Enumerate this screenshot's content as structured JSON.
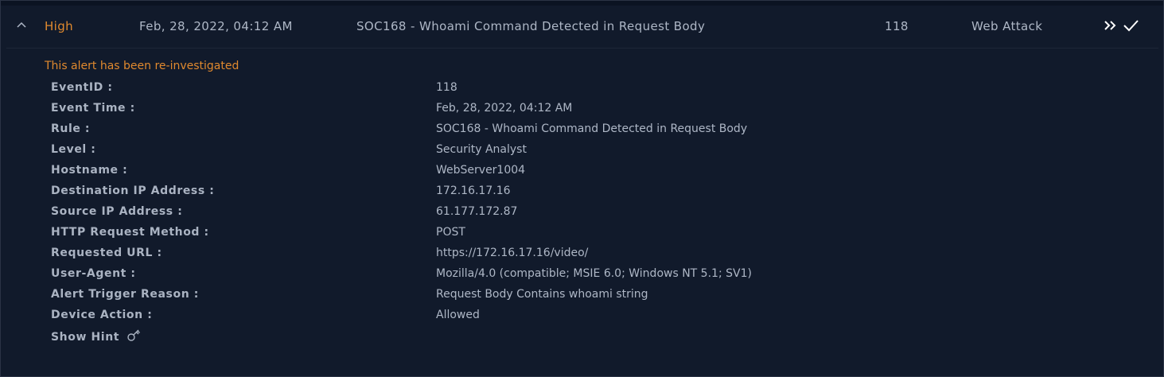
{
  "alert": {
    "severity": "High",
    "datetime": "Feb, 28, 2022, 04:12 AM",
    "rule": "SOC168 - Whoami Command Detected in Request Body",
    "event_id": "118",
    "type": "Web Attack",
    "severity_color": "#e0892e"
  },
  "detail": {
    "notice": "This alert has been re-investigated",
    "fields": [
      {
        "label": "EventID :",
        "value": "118"
      },
      {
        "label": "Event Time :",
        "value": "Feb, 28, 2022, 04:12 AM"
      },
      {
        "label": "Rule :",
        "value": "SOC168 - Whoami Command Detected in Request Body"
      },
      {
        "label": "Level :",
        "value": "Security Analyst"
      },
      {
        "label": "Hostname :",
        "value": "WebServer1004"
      },
      {
        "label": "Destination IP Address :",
        "value": "172.16.17.16"
      },
      {
        "label": "Source IP Address :",
        "value": "61.177.172.87"
      },
      {
        "label": "HTTP Request Method :",
        "value": "POST"
      },
      {
        "label": "Requested URL :",
        "value": "https://172.16.17.16/video/"
      },
      {
        "label": "User-Agent :",
        "value": "Mozilla/4.0 (compatible; MSIE 6.0; Windows NT 5.1; SV1)"
      },
      {
        "label": "Alert Trigger Reason :",
        "value": "Request Body Contains whoami string"
      },
      {
        "label": "Device Action :",
        "value": "Allowed"
      }
    ],
    "hint_label": "Show Hint"
  },
  "icons": {
    "collapse": "chevron-up-icon",
    "forward": "double-chevron-right-icon",
    "close": "checkmark-icon",
    "hint": "key-icon"
  }
}
